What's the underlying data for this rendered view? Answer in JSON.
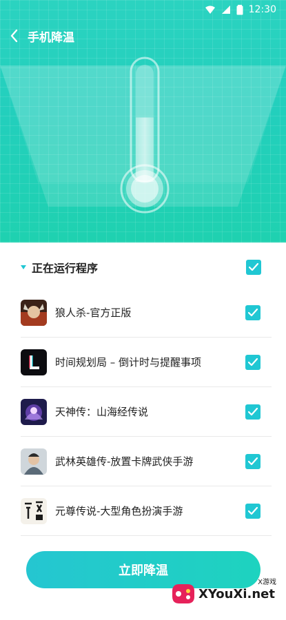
{
  "status": {
    "time": "12:30"
  },
  "header": {
    "title": "手机降温"
  },
  "section": {
    "title": "正在运行程序"
  },
  "apps": [
    {
      "name": "狼人杀-官方正版",
      "checked": true
    },
    {
      "name": "时间规划局 – 倒计时与提醒事项",
      "checked": true
    },
    {
      "name": "天神传：山海经传说",
      "checked": true
    },
    {
      "name": "武林英雄传-放置卡牌武侠手游",
      "checked": true
    },
    {
      "name": "元尊传说-大型角色扮演手游",
      "checked": true
    }
  ],
  "cta": {
    "label": "立即降温"
  },
  "watermark": {
    "brand": "XYouXi.net",
    "tag": "X游戏"
  },
  "colors": {
    "accent": "#20c7d3",
    "hero": "#23cfbd"
  },
  "thermometer": {
    "level": 0.55
  }
}
